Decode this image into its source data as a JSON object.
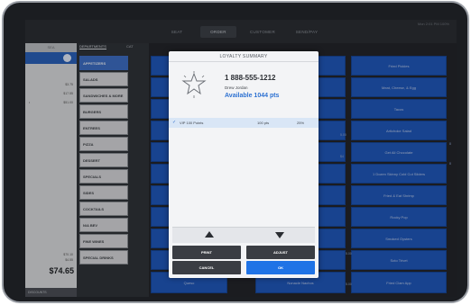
{
  "topbar": {
    "tabs": [
      {
        "label": "SEAT",
        "active": false
      },
      {
        "label": "ORDER",
        "active": true
      },
      {
        "label": "CUSTOMER",
        "active": false
      },
      {
        "label": "SEND/PAY",
        "active": false
      }
    ],
    "status": "Mon 2:01 PM   100%"
  },
  "check": {
    "header": "SEA",
    "lines": [
      {
        "name": "",
        "price": "$3.75"
      },
      {
        "name": "",
        "price": "$17.55"
      },
      {
        "name": "•",
        "price": "$51.00"
      }
    ],
    "subtotals": [
      "$70.10",
      "$4.55"
    ],
    "total": "$74.65",
    "pay_label": "DISCOUNTS"
  },
  "departments": {
    "header_primary": "DEPARTMENTS",
    "header_secondary": "CAT",
    "items": [
      "APPETIZERS",
      "SALADS",
      "SANDWICHES & MORE",
      "BURGERS",
      "ENTREES",
      "PIZZA",
      "DESSERT",
      "SPECIALS",
      "SIDES",
      "COCKTAILS",
      "N/A BEV",
      "FINE WINES",
      "SPECIAL DRINKS"
    ],
    "selected_index": 0
  },
  "grid": {
    "right_items": [
      "Fried Pickles",
      "Meat, Cheese, & Egg",
      "Tacos",
      "Artichoke Salad",
      "Get All Chocolate",
      "1 Dozen Skinny Cold Cut Sliders",
      "Fried & Eat Shrimp",
      "Rocky Pop",
      "Smoked Oysters",
      "Soto Trivet",
      "Fried Clam App"
    ],
    "bottom_items": [
      "Queso",
      "Nonacle Nachos"
    ],
    "price_tags": [
      "5.00",
      "$4",
      "5.00",
      "5.00",
      "8",
      "8"
    ]
  },
  "modal": {
    "title": "LOYALTY SUMMARY",
    "phone": "1 888-555-1212",
    "customer_name": "Drew Jordan",
    "available": "Available 1044 pts",
    "reward": {
      "name": "VIP 100 Points",
      "points": "100 pts",
      "percent": "25%"
    },
    "buttons": {
      "print": "PRINT",
      "adjust": "ADJUST",
      "cancel": "CANCEL",
      "ok": "OK"
    },
    "colors": {
      "accent": "#2e72d2",
      "ok": "#1f73e6"
    }
  }
}
